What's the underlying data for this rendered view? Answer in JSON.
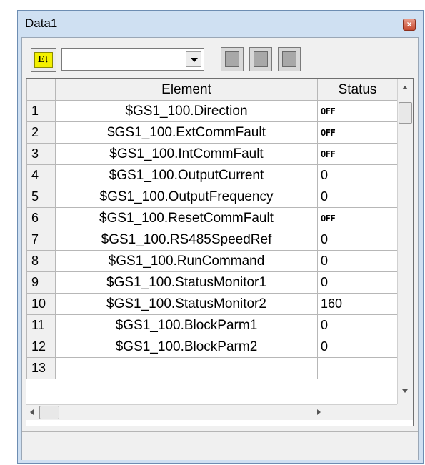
{
  "window": {
    "title": "Data1",
    "close_glyph": "×"
  },
  "toolbar": {
    "sort_label": "E↓",
    "combo_value": "",
    "buttons": [
      "blank-square-icon",
      "blank-square-icon",
      "blank-square-icon"
    ]
  },
  "grid": {
    "columns": [
      "Element",
      "Status"
    ],
    "rows": [
      {
        "num": "1",
        "element": "$GS1_100.Direction",
        "status": "OFF"
      },
      {
        "num": "2",
        "element": "$GS1_100.ExtCommFault",
        "status": "OFF"
      },
      {
        "num": "3",
        "element": "$GS1_100.IntCommFault",
        "status": "OFF"
      },
      {
        "num": "4",
        "element": "$GS1_100.OutputCurrent",
        "status": "0"
      },
      {
        "num": "5",
        "element": "$GS1_100.OutputFrequency",
        "status": "0"
      },
      {
        "num": "6",
        "element": "$GS1_100.ResetCommFault",
        "status": "OFF"
      },
      {
        "num": "7",
        "element": "$GS1_100.RS485SpeedRef",
        "status": "0"
      },
      {
        "num": "8",
        "element": "$GS1_100.RunCommand",
        "status": "0"
      },
      {
        "num": "9",
        "element": "$GS1_100.StatusMonitor1",
        "status": "0"
      },
      {
        "num": "10",
        "element": "$GS1_100.StatusMonitor2",
        "status": "160"
      },
      {
        "num": "11",
        "element": "$GS1_100.BlockParm1",
        "status": "0"
      },
      {
        "num": "12",
        "element": "$GS1_100.BlockParm2",
        "status": "0"
      },
      {
        "num": "13",
        "element": "",
        "status": ""
      }
    ]
  },
  "colors": {
    "sort_button": "#f3f000",
    "title_bar": "#cfe0f2",
    "close_button": "#c64a30"
  }
}
